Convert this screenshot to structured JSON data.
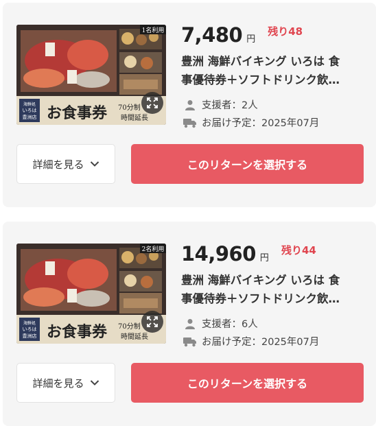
{
  "colors": {
    "accent": "#e85a63",
    "remain": "#e0454f"
  },
  "rewards": [
    {
      "image_text": {
        "vertical_label": "海鮮 いろは 豊洲店",
        "headline": "お食事券",
        "sub1": "70分制",
        "sub2": "時間延長",
        "badge": "1名利用"
      },
      "price": "7,480",
      "currency": "円",
      "remaining": "残り48",
      "title_line1": "豊洲 海鮮バイキング いろは 食",
      "title_line2": "事優待券＋ソフトドリンク飲…",
      "supporters": "支援者：2人",
      "delivery": "お届け予定：2025年07月",
      "detail_label": "詳細を見る",
      "select_label": "このリターンを選択する",
      "icons": {
        "expand": "expand-icon",
        "person": "person-icon",
        "truck": "truck-icon",
        "chevron": "chevron-down-icon"
      }
    },
    {
      "image_text": {
        "vertical_label": "海鮮 いろは 豊洲店",
        "headline": "お食事券",
        "sub1": "70分制",
        "sub2": "時間延長",
        "badge": "2名利用"
      },
      "price": "14,960",
      "currency": "円",
      "remaining": "残り44",
      "title_line1": "豊洲 海鮮バイキング いろは 食",
      "title_line2": "事優待券＋ソフトドリンク飲…",
      "supporters": "支援者：6人",
      "delivery": "お届け予定：2025年07月",
      "detail_label": "詳細を見る",
      "select_label": "このリターンを選択する",
      "icons": {
        "expand": "expand-icon",
        "person": "person-icon",
        "truck": "truck-icon",
        "chevron": "chevron-down-icon"
      }
    }
  ]
}
